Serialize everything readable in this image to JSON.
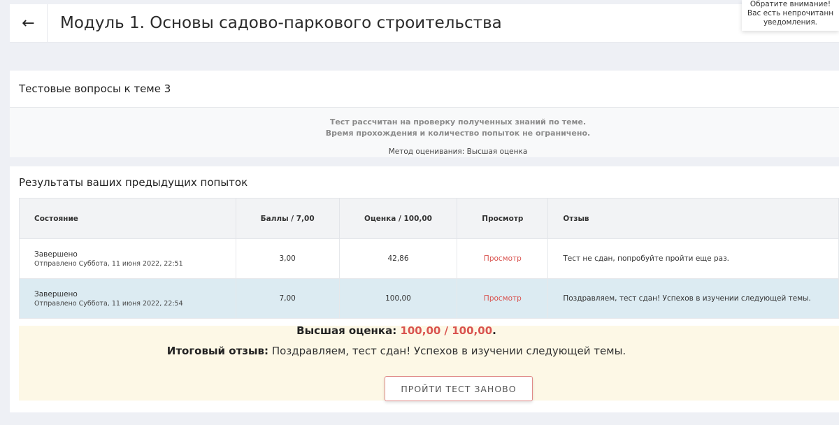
{
  "header": {
    "back_icon": "←",
    "title": "Модуль 1. Основы садово-паркового строительства"
  },
  "notice": {
    "line1": "Обратите внимание!",
    "line2": "Вас есть непрочитанн",
    "line3": "уведомления."
  },
  "test_section": {
    "title": "Тестовые вопросы к теме 3",
    "info_line1": "Тест рассчитан на проверку полученных знаний по теме.",
    "info_line2": "Время прохождения и количество попыток не ограничено.",
    "method": "Метод оценивания: Высшая оценка"
  },
  "results": {
    "title": "Результаты ваших предыдущих попыток",
    "columns": [
      "Состояние",
      "Баллы / 7,00",
      "Оценка / 100,00",
      "Просмотр",
      "Отзыв"
    ],
    "rows": [
      {
        "state": "Завершено",
        "submitted": "Отправлено Суббота, 11 июня 2022, 22:51",
        "score": "3,00",
        "grade": "42,86",
        "review": "Просмотр",
        "feedback": "Тест не сдан, попробуйте пройти еще раз."
      },
      {
        "state": "Завершено",
        "submitted": "Отправлено Суббота, 11 июня 2022, 22:54",
        "score": "7,00",
        "grade": "100,00",
        "review": "Просмотр",
        "feedback": "Поздравляем, тест сдан! Успехов в изучении следующей темы."
      }
    ]
  },
  "summary": {
    "best_label": "Высшая оценка:",
    "best_value": "100,00 / 100,00",
    "best_suffix": ".",
    "final_label": "Итоговый отзыв:",
    "final_text": "Поздравляем, тест сдан! Успехов в изучении следующей темы.",
    "retry_label": "ПРОЙТИ ТЕСТ ЗАНОВО"
  },
  "colors": {
    "accent": "#d9534f",
    "highlight_row": "#dcebf2",
    "summary_bg": "#fdf8e6"
  }
}
